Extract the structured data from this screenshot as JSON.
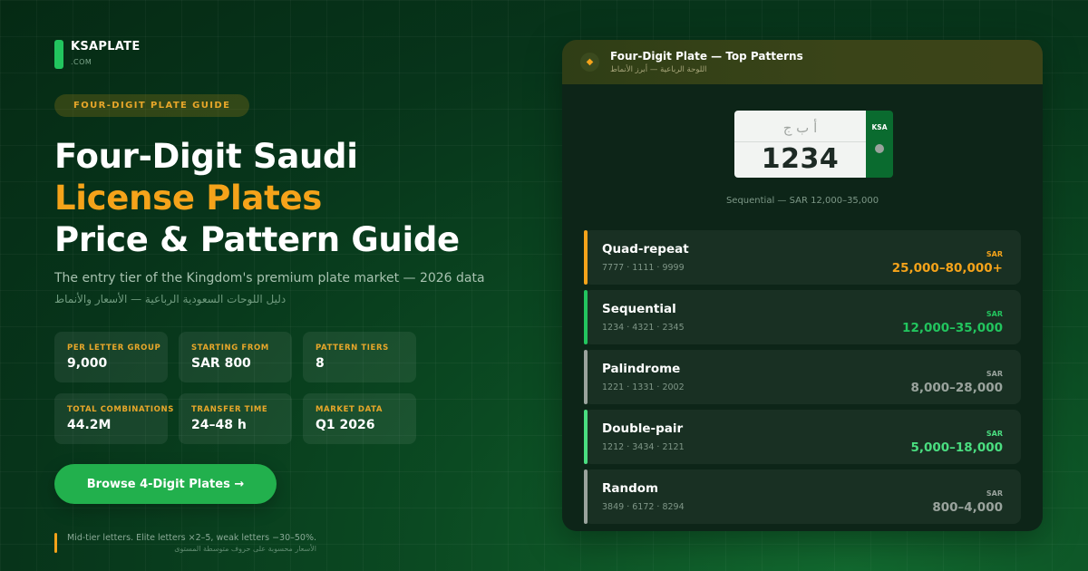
{
  "brand": {
    "name": "KSAPLATE",
    "sub": ".COM",
    "accent_color": "#22c55e"
  },
  "badge": "FOUR-DIGIT PLATE GUIDE",
  "title": {
    "line1": "Four-Digit Saudi",
    "line2": "License Plates",
    "line3": "Price & Pattern Guide"
  },
  "subtitle": "The entry tier of the Kingdom's premium plate market — 2026 data",
  "subtitle_ar": "دليل اللوحات السعودية الرباعية — الأسعار والأنماط",
  "stats": [
    {
      "label": "PER LETTER GROUP",
      "value": "9,000"
    },
    {
      "label": "STARTING FROM",
      "value": "SAR 800"
    },
    {
      "label": "PATTERN TIERS",
      "value": "8"
    },
    {
      "label": "TOTAL COMBINATIONS",
      "value": "44.2M"
    },
    {
      "label": "TRANSFER TIME",
      "value": "24–48 h"
    },
    {
      "label": "MARKET DATA",
      "value": "Q1 2026"
    }
  ],
  "cta": {
    "label": "Browse 4-Digit Plates →"
  },
  "note": {
    "en": "Mid-tier letters. Elite letters ×2–5, weak letters −30–50%.",
    "ar": "الأسعار محسوبة على حروف متوسطة المستوى"
  },
  "card": {
    "header_icon": "diamond-icon",
    "title": "Four-Digit Plate — Top Patterns",
    "subtitle_ar": "اللوحة الرباعية — أبرز الأنماط",
    "plate": {
      "letters_ar": "أ ب ج",
      "number": "1234",
      "country": "KSA"
    },
    "plate_caption": "Sequential — SAR 12,000–35,000",
    "tiers": [
      {
        "name": "Quad-repeat",
        "examples": "7777 · 1111 · 9999",
        "currency": "SAR",
        "price": "25,000–80,000+",
        "color": "#f5a31a"
      },
      {
        "name": "Sequential",
        "examples": "1234 · 4321 · 2345",
        "currency": "SAR",
        "price": "12,000–35,000",
        "color": "#22c55e"
      },
      {
        "name": "Palindrome",
        "examples": "1221 · 1331 · 2002",
        "currency": "SAR",
        "price": "8,000–28,000",
        "color": "#9aa39d"
      },
      {
        "name": "Double-pair",
        "examples": "1212 · 3434 · 2121",
        "currency": "SAR",
        "price": "5,000–18,000",
        "color": "#4ade80"
      },
      {
        "name": "Random",
        "examples": "3849 · 6172 · 8294",
        "currency": "SAR",
        "price": "800–4,000",
        "color": "#9aa39d"
      }
    ]
  }
}
